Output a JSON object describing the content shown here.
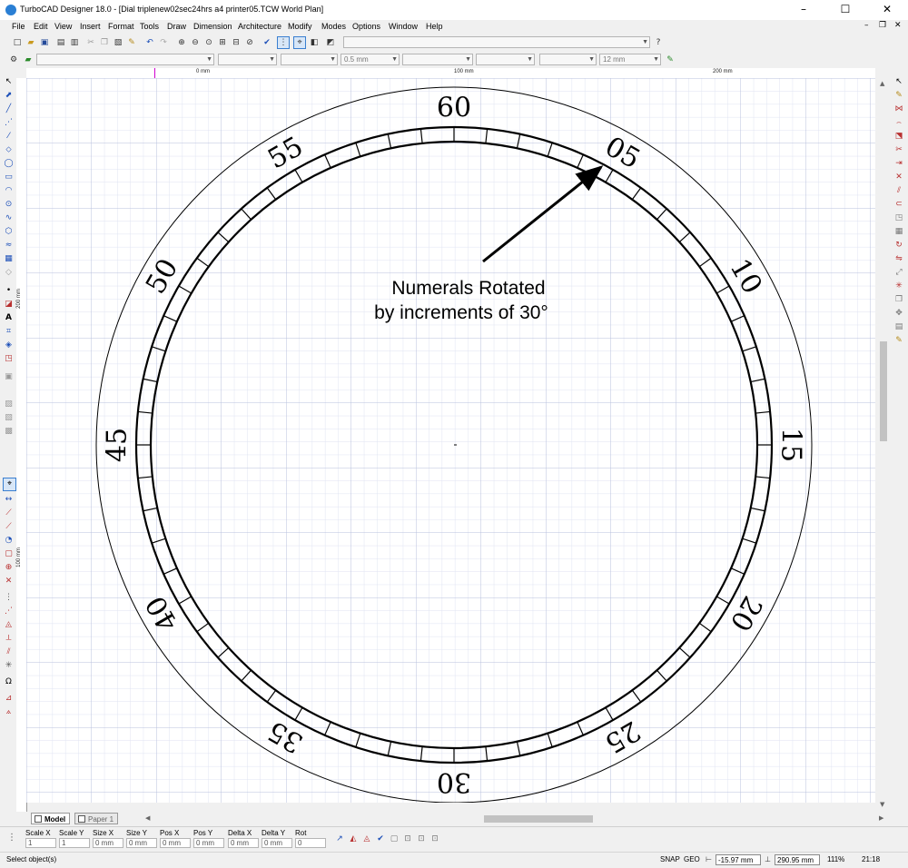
{
  "window": {
    "title": "TurboCAD Designer 18.0 - [Dial triplenew02sec24hrs a4 printer05.TCW World Plan]",
    "controls": {
      "minimize": "–",
      "maximize": "☐",
      "close": "✕"
    },
    "mdi_controls": {
      "minimize": "–",
      "restore": "❐",
      "close": "✕"
    }
  },
  "menu": [
    "File",
    "Edit",
    "View",
    "Insert",
    "Format",
    "Tools",
    "Draw",
    "Dimension",
    "Architecture",
    "Modify",
    "Modes",
    "Options",
    "Window",
    "Help"
  ],
  "property_bar": {
    "line_width": "0.5 mm",
    "text_size": "12 mm"
  },
  "ruler": {
    "top_labels": [
      "0 mm",
      "100 mm",
      "200 mm"
    ],
    "left_labels": [
      "200 mm",
      "100 mm"
    ]
  },
  "drawing": {
    "dial_numerals": [
      "60",
      "05",
      "10",
      "15",
      "20",
      "25",
      "30",
      "35",
      "40",
      "45",
      "50",
      "55"
    ],
    "annotation_line1": "Numerals Rotated",
    "annotation_line2": "by increments of 30°",
    "colors": {
      "grid_minor": "#dfe3f2",
      "grid_major": "#b9c0de",
      "ink": "#000000"
    }
  },
  "tabs": {
    "model": "Model",
    "paper": "Paper 1"
  },
  "inspector": [
    {
      "label": "Scale X",
      "value": "1"
    },
    {
      "label": "Scale Y",
      "value": "1"
    },
    {
      "label": "Size X",
      "value": "0 mm"
    },
    {
      "label": "Size Y",
      "value": "0 mm"
    },
    {
      "label": "Pos X",
      "value": "0 mm"
    },
    {
      "label": "Pos Y",
      "value": "0 mm"
    },
    {
      "label": "Delta X",
      "value": "0 mm"
    },
    {
      "label": "Delta Y",
      "value": "0 mm"
    },
    {
      "label": "Rot",
      "value": "0"
    }
  ],
  "status": {
    "prompt": "Select object(s)",
    "snap": "SNAP",
    "geo": "GEO",
    "coord_x": "-15.97 mm",
    "coord_y": "290.95 mm",
    "zoom": "111%",
    "time": "21:18"
  }
}
